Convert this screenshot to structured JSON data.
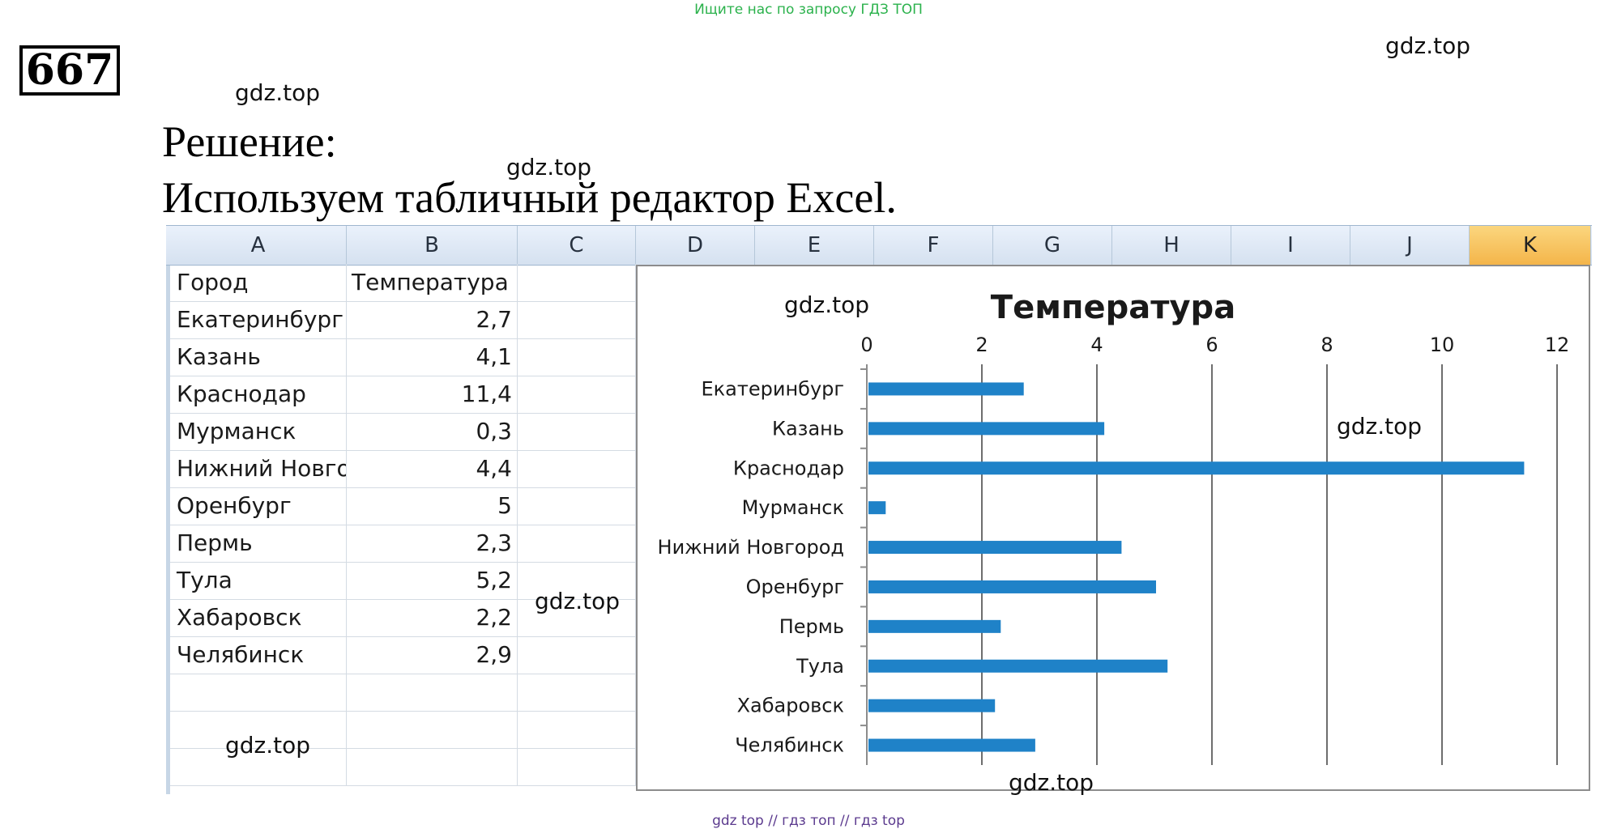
{
  "top_banner": "Ищите нас по запросу ГДЗ ТОП",
  "task_number": "667",
  "heading_line1": "Решение:",
  "heading_line2": "Используем табличный редактор Excel.",
  "watermark": "gdz.top",
  "bottom_links": "gdz top  //  гдз топ  //  гдз top",
  "spreadsheet": {
    "columns": [
      "A",
      "B",
      "C",
      "D",
      "E",
      "F",
      "G",
      "H",
      "I",
      "J",
      "K"
    ],
    "selected_column": "K",
    "header_row": [
      "Город",
      "Температура"
    ],
    "rows": [
      {
        "city": "Екатеринбург",
        "value": "2,7"
      },
      {
        "city": "Казань",
        "value": "4,1"
      },
      {
        "city": "Краснодар",
        "value": "11,4"
      },
      {
        "city": "Мурманск",
        "value": "0,3"
      },
      {
        "city": "Нижний Новго",
        "value": "4,4"
      },
      {
        "city": "Оренбург",
        "value": "5"
      },
      {
        "city": "Пермь",
        "value": "2,3"
      },
      {
        "city": "Тула",
        "value": "5,2"
      },
      {
        "city": "Хабаровск",
        "value": "2,2"
      },
      {
        "city": "Челябинск",
        "value": "2,9"
      }
    ]
  },
  "colors": {
    "bar": "#1f82c8",
    "selected_header": "#f4b54a"
  },
  "chart_data": {
    "type": "bar",
    "orientation": "horizontal",
    "title": "Температура",
    "categories": [
      "Екатеринбург",
      "Казань",
      "Краснодар",
      "Мурманск",
      "Нижний Новгород",
      "Оренбург",
      "Пермь",
      "Тула",
      "Хабаровск",
      "Челябинск"
    ],
    "values": [
      2.7,
      4.1,
      11.4,
      0.3,
      4.4,
      5,
      2.3,
      5.2,
      2.2,
      2.9
    ],
    "xlim": [
      0,
      12
    ],
    "ticks": [
      0,
      2,
      4,
      6,
      8,
      10,
      12
    ],
    "tick_labels": [
      "0",
      "2",
      "4",
      "6",
      "8",
      "10",
      "12"
    ],
    "axis_position": "top",
    "grid": true,
    "legend": "none"
  }
}
